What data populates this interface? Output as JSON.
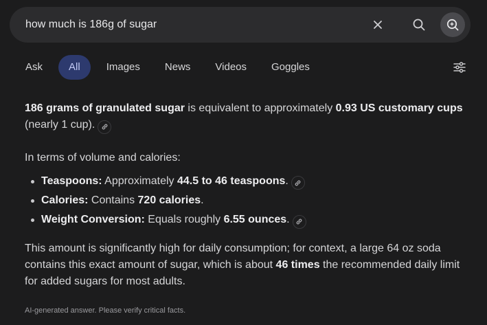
{
  "search": {
    "query": "how much is 186g of sugar",
    "clear_icon": "close-icon",
    "search_icon": "search-icon",
    "ai_icon": "ai-sparkle-icon"
  },
  "tabs": [
    {
      "label": "Ask",
      "active": false
    },
    {
      "label": "All",
      "active": true
    },
    {
      "label": "Images",
      "active": false
    },
    {
      "label": "News",
      "active": false
    },
    {
      "label": "Videos",
      "active": false
    },
    {
      "label": "Goggles",
      "active": false
    }
  ],
  "filter_icon": "sliders-icon",
  "colors": {
    "background": "#1c1c1d",
    "search_bar": "#2c2c2e",
    "active_tab": "#2d3a6e",
    "active_tab_text": "#c3cbf6"
  },
  "answer": {
    "p1": {
      "bold1": "186 grams of granulated sugar",
      "text1": " is equivalent to approximately ",
      "bold2": "0.93 US customary cups",
      "text2": " (nearly 1 cup)."
    },
    "p2": "In terms of volume and calories:",
    "items": [
      {
        "label": "Teaspoons:",
        "text": " Approximately ",
        "bold": "44.5 to 46 teaspoons",
        "end": ".",
        "cited": true
      },
      {
        "label": "Calories:",
        "text": " Contains ",
        "bold": "720 calories",
        "end": ".",
        "cited": false
      },
      {
        "label": "Weight Conversion:",
        "text": " Equals roughly ",
        "bold": "6.55 ounces",
        "end": ".",
        "cited": true
      }
    ],
    "p3": {
      "text1": "This amount is significantly high for daily consumption; for context, a large 64 oz soda contains this exact amount of sugar, which is about ",
      "bold": "46 times",
      "text2": " the recommended daily limit for added sugars for most adults."
    },
    "cite_icon": "link-icon"
  },
  "disclaimer": "AI-generated answer. Please verify critical facts."
}
